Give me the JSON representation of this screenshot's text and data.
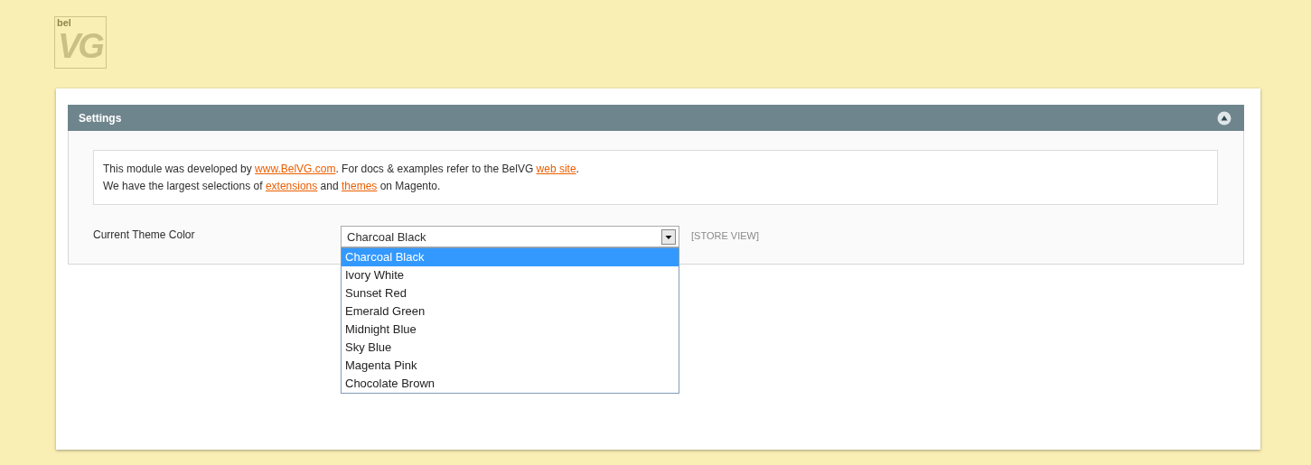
{
  "logo": {
    "small": "bel",
    "large": "VG"
  },
  "section": {
    "title": "Settings",
    "expanded": true
  },
  "notice": {
    "lines": [
      [
        {
          "kind": "text",
          "text": "This module was developed by "
        },
        {
          "kind": "link",
          "text": "www.BelVG.com"
        },
        {
          "kind": "text",
          "text": ". For docs & examples refer to the BelVG "
        },
        {
          "kind": "link",
          "text": "web site"
        },
        {
          "kind": "text",
          "text": "."
        }
      ],
      [
        {
          "kind": "text",
          "text": "We have the largest selections of "
        },
        {
          "kind": "link",
          "text": "extensions"
        },
        {
          "kind": "text",
          "text": " and "
        },
        {
          "kind": "link",
          "text": "themes"
        },
        {
          "kind": "text",
          "text": " on Magento."
        }
      ]
    ]
  },
  "field": {
    "label": "Current Theme Color",
    "value": "Charcoal Black",
    "scope": "[STORE VIEW]",
    "open": true,
    "options": [
      {
        "label": "Charcoal Black",
        "selected": true
      },
      {
        "label": "Ivory White",
        "selected": false
      },
      {
        "label": "Sunset Red",
        "selected": false
      },
      {
        "label": "Emerald Green",
        "selected": false
      },
      {
        "label": "Midnight Blue",
        "selected": false
      },
      {
        "label": "Sky Blue",
        "selected": false
      },
      {
        "label": "Magenta Pink",
        "selected": false
      },
      {
        "label": "Chocolate Brown",
        "selected": false
      }
    ]
  }
}
